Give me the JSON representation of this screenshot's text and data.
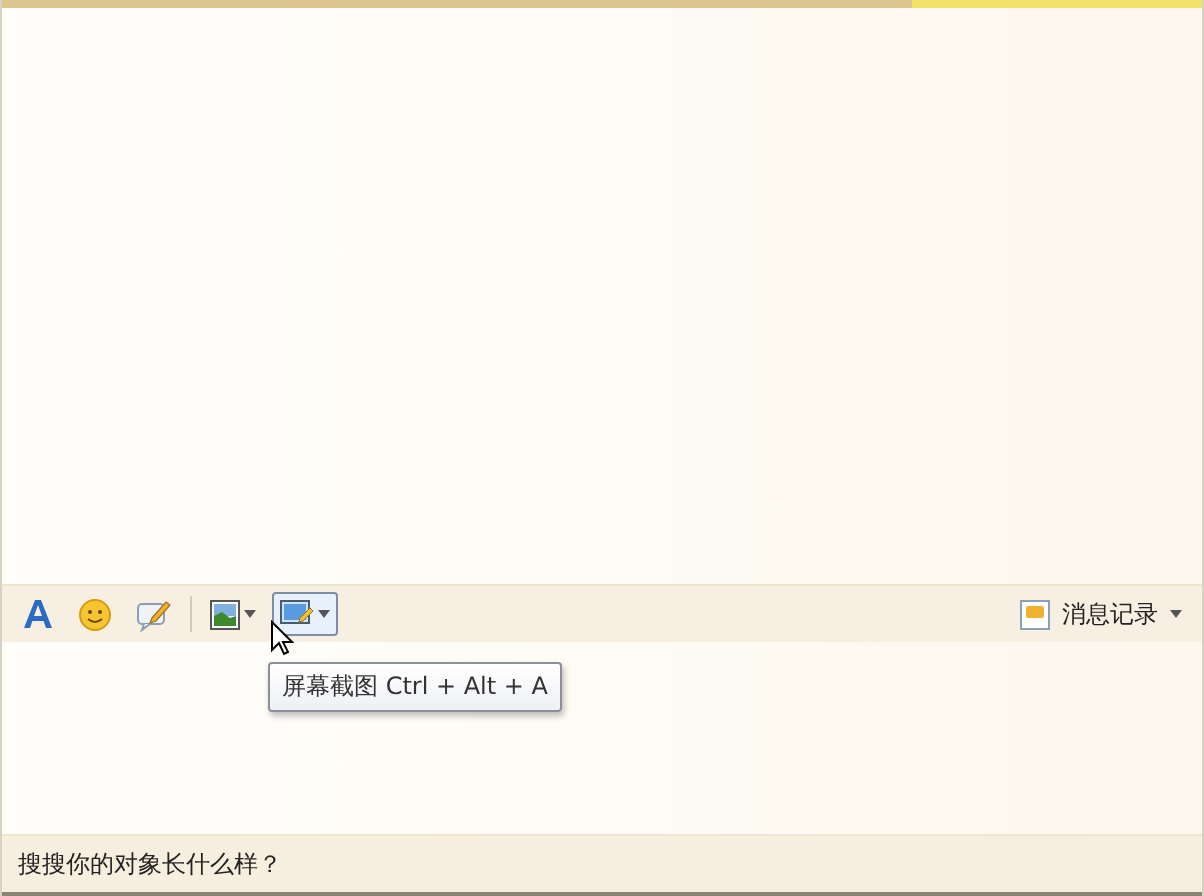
{
  "toolbar": {
    "tools": [
      {
        "kind": "font",
        "hovered": false,
        "dropdown": false
      },
      {
        "kind": "emoji",
        "hovered": false,
        "dropdown": false
      },
      {
        "kind": "note",
        "hovered": false,
        "dropdown": false
      },
      {
        "kind": "image",
        "hovered": false,
        "dropdown": true
      },
      {
        "kind": "screenshot",
        "hovered": true,
        "dropdown": true
      }
    ],
    "tooltip": "屏幕截图 Ctrl + Alt + A",
    "history": {
      "label": "消息记录"
    }
  },
  "footer": {
    "link": "搜搜你的对象长什么样？"
  }
}
